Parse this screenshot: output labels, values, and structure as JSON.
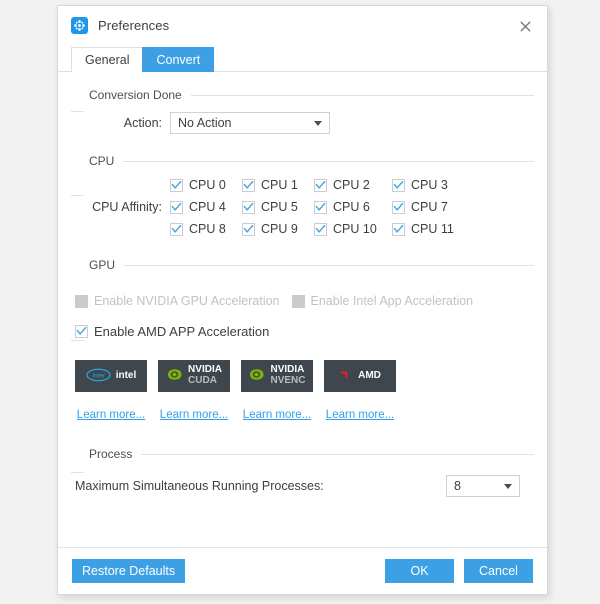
{
  "window": {
    "title": "Preferences",
    "icon": "preferences-gear-icon",
    "close_icon": "close-icon",
    "accent_color": "#3da0e5",
    "link_color": "#30a0e8",
    "badge_bg_color": "#3f464e"
  },
  "tabs": [
    {
      "label": "General",
      "active": false
    },
    {
      "label": "Convert",
      "active": true
    }
  ],
  "conversion_done": {
    "group_label": "Conversion Done",
    "action_label": "Action:",
    "action_value": "No Action"
  },
  "cpu": {
    "group_label": "CPU",
    "affinity_label": "CPU Affinity:",
    "cores": [
      {
        "label": "CPU 0",
        "checked": true
      },
      {
        "label": "CPU 1",
        "checked": true
      },
      {
        "label": "CPU 2",
        "checked": true
      },
      {
        "label": "CPU 3",
        "checked": true
      },
      {
        "label": "CPU 4",
        "checked": true
      },
      {
        "label": "CPU 5",
        "checked": true
      },
      {
        "label": "CPU 6",
        "checked": true
      },
      {
        "label": "CPU 7",
        "checked": true
      },
      {
        "label": "CPU 8",
        "checked": true
      },
      {
        "label": "CPU 9",
        "checked": true
      },
      {
        "label": "CPU 10",
        "checked": true
      },
      {
        "label": "CPU 11",
        "checked": true
      }
    ]
  },
  "gpu": {
    "group_label": "GPU",
    "nvidia_label": "Enable NVIDIA GPU Acceleration",
    "intel_label": "Enable Intel App Acceleration",
    "amd_label": "Enable AMD APP Acceleration",
    "badges": [
      {
        "name": "intel",
        "main": "intel",
        "sub": ""
      },
      {
        "name": "nvidia-cuda",
        "main": "NVIDIA",
        "sub": "CUDA"
      },
      {
        "name": "nvidia-nvenc",
        "main": "NVIDIA",
        "sub": "NVENC"
      },
      {
        "name": "amd",
        "main": "AMD",
        "sub": ""
      }
    ],
    "learn_more": [
      "Learn more...",
      "Learn more...",
      "Learn more...",
      "Learn more..."
    ]
  },
  "process": {
    "group_label": "Process",
    "max_label": "Maximum Simultaneous Running Processes:",
    "max_value": "8"
  },
  "footer": {
    "restore_defaults": "Restore Defaults",
    "ok": "OK",
    "cancel": "Cancel"
  }
}
